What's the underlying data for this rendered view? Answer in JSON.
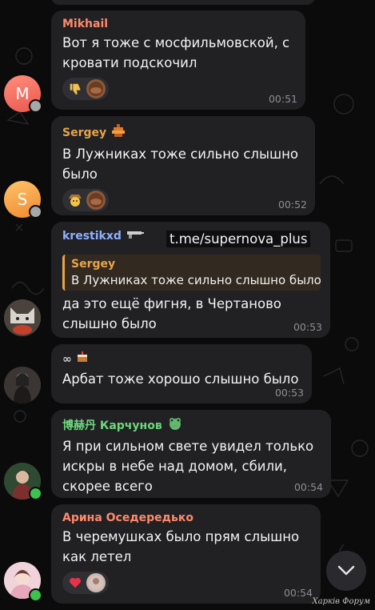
{
  "colors": {
    "background": "#0b0b0c",
    "bubble": "#212124",
    "name_mikhail": "#ff8a6b",
    "name_sergey": "#e7a54b",
    "name_krestik": "#8fb0ff",
    "name_karchunov": "#6dd67d",
    "name_arina": "#ff8a6b",
    "online_dot": "#3ec24f",
    "offline_dot": "#a7a7a7"
  },
  "messages": [
    {
      "author": "Mikhail",
      "text": "Вот я тоже с мосфильмовской, с кровати подскочил",
      "time": "00:51",
      "avatar_letter": "M",
      "reactions": [
        "thumbs-down",
        "avatar-reaction"
      ]
    },
    {
      "author": "Sergey",
      "text": "В Лужниках тоже сильно слышно было",
      "time": "00:52",
      "avatar_letter": "S",
      "badge_icon": "fire-pixel-badge",
      "reactions": [
        "cowboy-emoji",
        "avatar-reaction"
      ]
    },
    {
      "author": "krestikxd",
      "badge_icon": "gun-badge",
      "reply": {
        "author": "Sergey",
        "text": "В Лужниках тоже сильно слышно было"
      },
      "text": "да это ещё фигня, в Чертаново слышно было",
      "time": "00:53"
    },
    {
      "author": "∞",
      "badge_icon": "cake-badge",
      "text": "Арбат тоже хорошо слышно было",
      "time": "00:53"
    },
    {
      "author": "博赫丹 Карчунов",
      "badge_icon": "frog-heart-badge",
      "text": "Я при сильном свете увидел только искры в небе над домом, сбили, скорее всего",
      "time": "00:54"
    },
    {
      "author": "Арина Оседередько",
      "text": "В черемушках было прям слышно как летел",
      "time": "00:54",
      "reactions": [
        "red-heart",
        "avatar-reaction"
      ]
    }
  ],
  "overlay": {
    "channel_link": "t.me/supernova_plus",
    "forum_mark": "Харків Форум"
  },
  "controls": {
    "scroll_down_icon": "chevron-down-icon"
  }
}
